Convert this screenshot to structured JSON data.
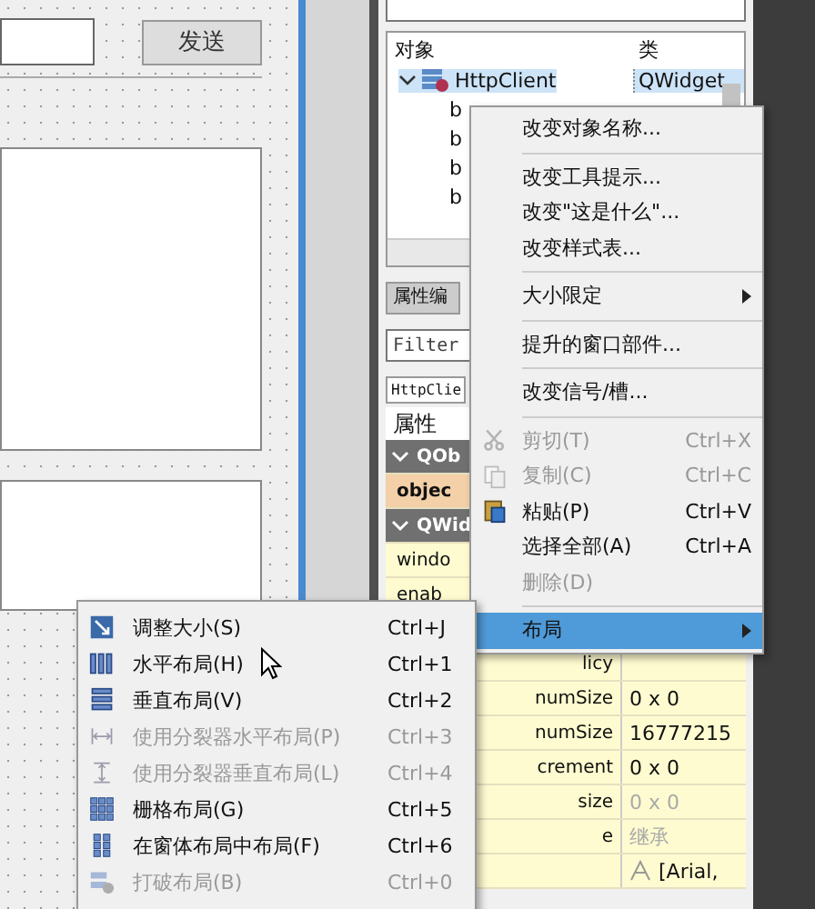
{
  "form": {
    "send_button": "发送"
  },
  "object_inspector": {
    "columns": [
      "对象",
      "类"
    ],
    "rows": [
      {
        "name": "HttpClient",
        "class": "QWidget",
        "selected": true,
        "expanded": true
      },
      {
        "name": "b",
        "selected": false
      },
      {
        "name": "b",
        "selected": false
      },
      {
        "name": "b",
        "selected": false
      },
      {
        "name": "b",
        "selected": false
      }
    ]
  },
  "property_editor": {
    "title": "属性编",
    "filter": {
      "placeholder": "Filter"
    },
    "object": "HttpClie",
    "header": "属性",
    "upper_rows": [
      {
        "kind": "group",
        "name": "QOb"
      },
      {
        "kind": "changed",
        "name": "objec"
      },
      {
        "kind": "group",
        "name": "QWid"
      },
      {
        "kind": "plain",
        "name": "windo"
      },
      {
        "kind": "plain",
        "name": "enab"
      }
    ],
    "lower_rows": [
      {
        "kind": "plain",
        "name": "licy"
      },
      {
        "kind": "plain",
        "name": "numSize",
        "value": "0 x 0"
      },
      {
        "kind": "plain",
        "name": "numSize",
        "value": "16777215"
      },
      {
        "kind": "plain",
        "name": "crement",
        "value": "0 x 0"
      },
      {
        "kind": "disabled",
        "name": "size",
        "value": "0 x 0"
      },
      {
        "kind": "disabled",
        "name": "e",
        "value": "继承"
      },
      {
        "kind": "font",
        "value": "[Arial,"
      }
    ]
  },
  "context_menu": [
    {
      "kind": "item",
      "label": "改变对象名称...",
      "disabled": false
    },
    {
      "kind": "separator"
    },
    {
      "kind": "item",
      "label": "改变工具提示...",
      "disabled": false
    },
    {
      "kind": "item",
      "label": "改变\"这是什么\"...",
      "disabled": false
    },
    {
      "kind": "item",
      "label": "改变样式表...",
      "disabled": false
    },
    {
      "kind": "separator"
    },
    {
      "kind": "submenu",
      "label": "大小限定",
      "selected": false
    },
    {
      "kind": "separator"
    },
    {
      "kind": "item",
      "label": "提升的窗口部件...",
      "disabled": false
    },
    {
      "kind": "separator"
    },
    {
      "kind": "item",
      "label": "改变信号/槽...",
      "disabled": false
    },
    {
      "kind": "separator"
    },
    {
      "kind": "item",
      "label": "剪切(T)",
      "shortcut": "Ctrl+X",
      "disabled": true
    },
    {
      "kind": "item",
      "label": "复制(C)",
      "shortcut": "Ctrl+C",
      "disabled": true
    },
    {
      "kind": "item",
      "label": "粘贴(P)",
      "shortcut": "Ctrl+V",
      "disabled": false
    },
    {
      "kind": "item",
      "label": "选择全部(A)",
      "shortcut": "Ctrl+A",
      "disabled": false
    },
    {
      "kind": "item",
      "label": "删除(D)",
      "disabled": true
    },
    {
      "kind": "separator"
    },
    {
      "kind": "submenu",
      "label": "布局",
      "selected": true
    }
  ],
  "layout_submenu": [
    {
      "label": "调整大小(S)",
      "shortcut": "Ctrl+J",
      "disabled": false
    },
    {
      "label": "水平布局(H)",
      "shortcut": "Ctrl+1",
      "disabled": false
    },
    {
      "label": "垂直布局(V)",
      "shortcut": "Ctrl+2",
      "disabled": false
    },
    {
      "label": "使用分裂器水平布局(P)",
      "shortcut": "Ctrl+3",
      "disabled": true
    },
    {
      "label": "使用分裂器垂直布局(L)",
      "shortcut": "Ctrl+4",
      "disabled": true
    },
    {
      "label": "栅格布局(G)",
      "shortcut": "Ctrl+5",
      "disabled": false
    },
    {
      "label": "在窗体布局中布局(F)",
      "shortcut": "Ctrl+6",
      "disabled": false
    },
    {
      "label": "打破布局(B)",
      "shortcut": "Ctrl+0",
      "disabled": true
    }
  ]
}
